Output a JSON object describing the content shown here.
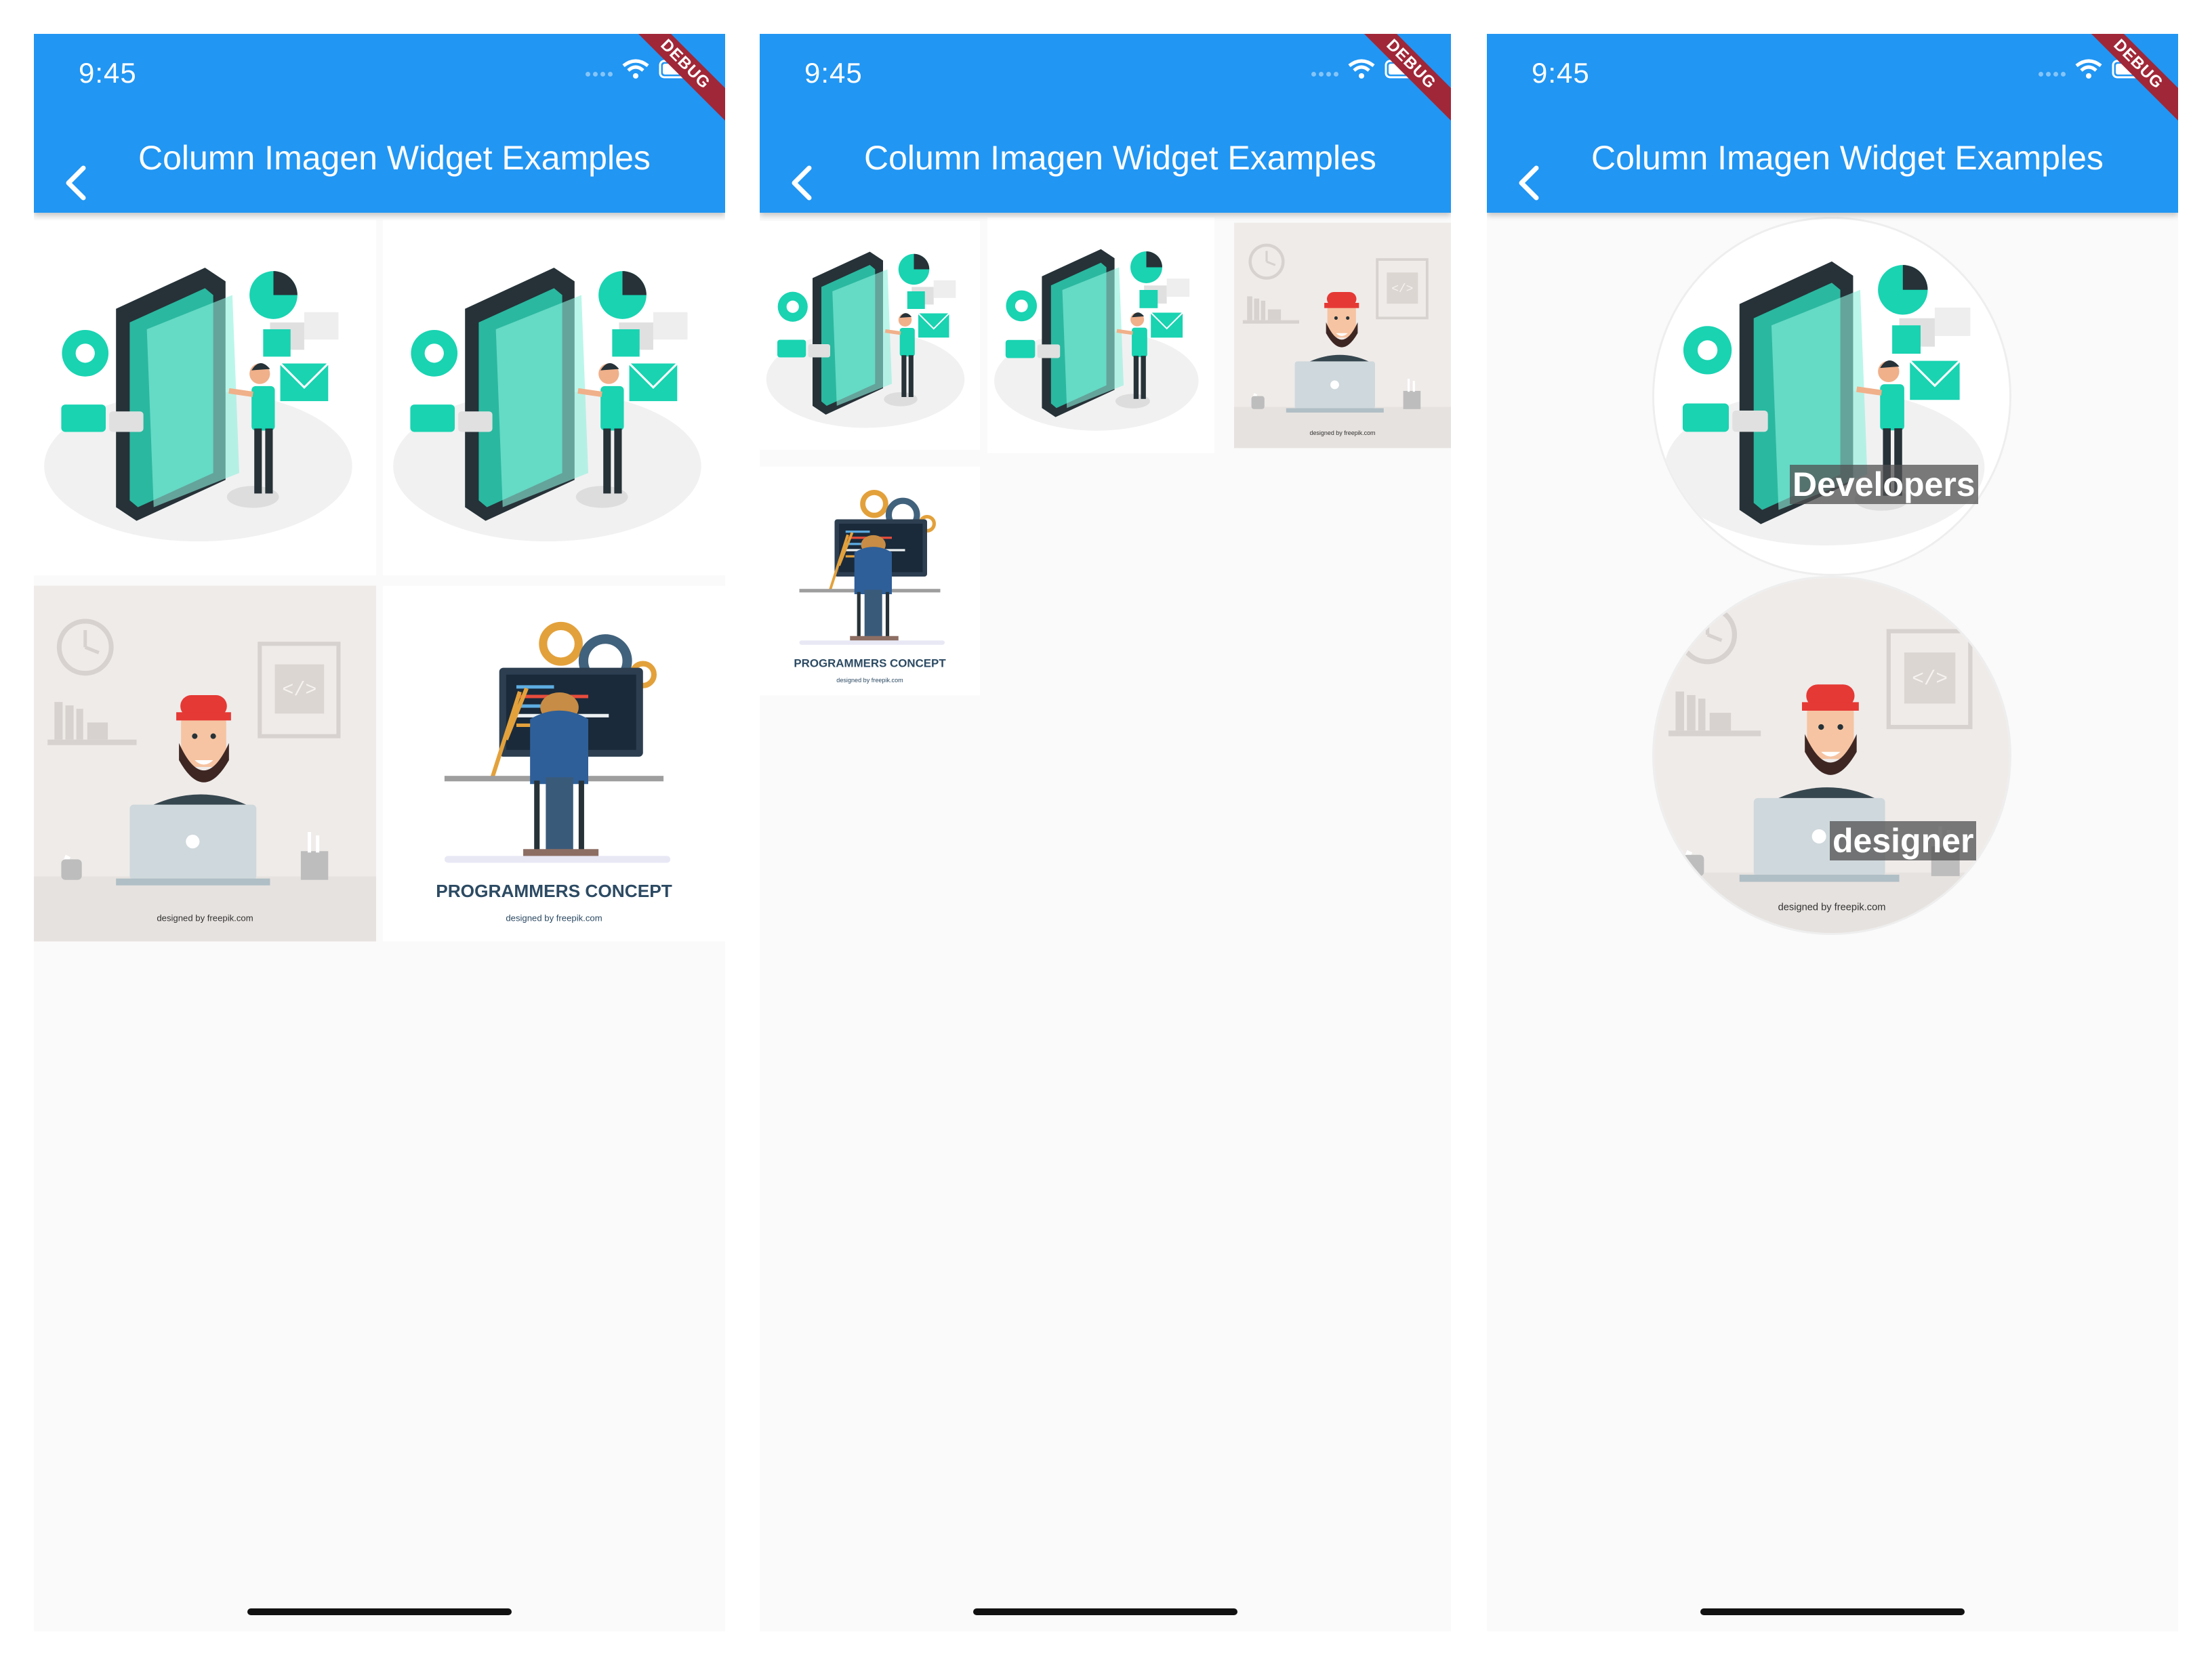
{
  "screens": [
    {
      "status_time": "9:45",
      "title": "Column Imagen Widget Examples",
      "debug_label": "DEBUG"
    },
    {
      "status_time": "9:45",
      "title": "Column Imagen Widget Examples",
      "debug_label": "DEBUG"
    },
    {
      "status_time": "9:45",
      "title": "Column Imagen Widget Examples",
      "debug_label": "DEBUG"
    }
  ],
  "images": {
    "programmers": {
      "caption": "PROGRAMMERS CONCEPT",
      "credit": "designed by freepik.com"
    },
    "designer": {
      "credit": "designed by freepik.com"
    }
  },
  "circle_labels": {
    "developers": "Developers",
    "designer": "designer"
  },
  "icons": [
    "back-arrow-icon",
    "wifi-icon",
    "battery-icon",
    "signal-icon"
  ],
  "colors": {
    "appbar": "#2196f3",
    "background": "#fafafa",
    "debug_ribbon": "#a02738",
    "accent_teal": "#19d3b1"
  }
}
